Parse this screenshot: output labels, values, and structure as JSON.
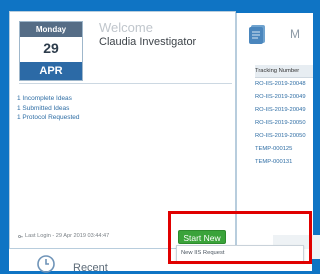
{
  "calendar": {
    "weekday": "Monday",
    "day": "29",
    "month": "APR"
  },
  "welcome": {
    "title": "Welcome",
    "user": "Claudia Investigator"
  },
  "stats": [
    "1 Incomplete Ideas",
    "1 Submitted Ideas",
    "1 Protocol Requested"
  ],
  "last_login": "Last Login - 29 Apr 2019 03:44:47",
  "right_panel": {
    "title": "M",
    "header": "Tracking Number",
    "rows": [
      "RO-IIS-2019-20048",
      "RO-IIS-2019-20049",
      "RO-IIS-2019-20049",
      "RO-IIS-2019-20050",
      "RO-IIS-2019-20050",
      "TEMP-000125",
      "TEMP-000131"
    ]
  },
  "actions": {
    "start_new": "Start New",
    "menu_items": [
      "New IIS Request"
    ]
  },
  "recent": {
    "label": "Recent"
  },
  "colors": {
    "background": "#0f74c4",
    "button_green": "#3aa33a",
    "highlight_red": "#e00000",
    "link_blue": "#2e6da4"
  }
}
